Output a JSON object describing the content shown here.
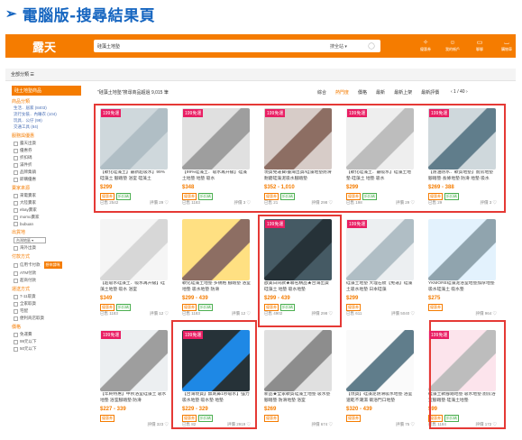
{
  "page_title": {
    "arrow": "➢",
    "text": "電腦版-搜尋結果頁"
  },
  "header": {
    "logo": "露天",
    "search_query": "硅藻土地墊",
    "search_scope": "搜全站 ▾",
    "nav": [
      {
        "icon": "tag-icon",
        "glyph": "✧",
        "label": "優惠券"
      },
      {
        "icon": "user-icon",
        "glyph": "☺",
        "label": "我的帳戶"
      },
      {
        "icon": "chat-icon",
        "glyph": "▭",
        "label": "聊聊"
      },
      {
        "icon": "cart-icon",
        "glyph": "⌴",
        "label": "購物車"
      }
    ]
  },
  "subbar": {
    "all_categories": "全部分類 ☰"
  },
  "sidebar": {
    "header": "硅土地墊商品",
    "sections": [
      {
        "title": "商品分類",
        "links": [
          "生活．居家 (8403)",
          "流行女裝．內睡衣 (104)",
          "玩具．公仔 (99)",
          "交通工具 (84)"
        ]
      },
      {
        "title": "服務與優惠",
        "checks": [
          "露天出貨",
          "優惠券",
          "折扣碼",
          "滿件折",
          "品牌集鎮",
          "即購優惠"
        ]
      },
      {
        "title": "賣家來源",
        "checks": [
          "來電賣家",
          "大陸賣家",
          "ebay賣家",
          "momo賣家",
          "bubuan"
        ]
      },
      {
        "title": "出貨地",
        "select": "台灣地區 ▾",
        "checks": [
          "海外出貨"
        ]
      },
      {
        "title": "付款方式",
        "checks": [
          "信用卡付款",
          "ATM付款",
          "超商付款"
        ],
        "ad": "想申請嗎"
      },
      {
        "title": "運送方式",
        "checks": [
          "7-11取貨",
          "全家取貨",
          "宅配",
          "便利商店取貨"
        ]
      },
      {
        "title": "價格",
        "checks": [
          "免運費",
          "99元以下",
          "50元以下"
        ]
      }
    ]
  },
  "results": {
    "info": "\"硅藻土地墊\"搜尋商品超過 9,015 筆",
    "sort": [
      "綜合",
      "熱門度",
      "價格",
      "最新",
      "最新上架",
      "最新評價"
    ],
    "active_sort": "熱門度",
    "pager": "‹  1 / 40  ›"
  },
  "products": [
    {
      "badge": "199免運",
      "name": "【軟化硅藻土】最新超吸水】99%硅藻土 腳踏墊 浴室 硅藻土",
      "price": "$299",
      "tags": [
        "優惠券",
        "折扣碼"
      ],
      "sold": "已售 2542",
      "rating": "評價 29"
    },
    {
      "badge": "199免運",
      "name": "【99%硅藻土．吸水再升級】硅藻土地墊 地墊 吸水",
      "price": "$348",
      "tags": [
        "優惠券",
        "折扣碼"
      ],
      "sold": "已售 1183",
      "rating": "評價 3"
    },
    {
      "badge": "199免運",
      "name": "現貨免運費/臺灣出貨/硅藻地墊防滑耐磨硅藻泥吸水腳踏墊",
      "price": "$352 - 1,010",
      "tags": [
        "優惠券",
        "折扣碼"
      ],
      "sold": "已售 21",
      "rating": "評價 298"
    },
    {
      "badge": "199免運",
      "name": "【軟化硅藻土．最吸水】硅藻土地墊 硅藻土 地墊 吸水",
      "price": "$299",
      "tags": [
        "優惠券",
        "折扣碼"
      ],
      "sold": "已售 198",
      "rating": "評價 29"
    },
    {
      "badge": "199免運",
      "name": "【防油防水．軟質地墊】廚房地墊 腳踏墊 長條地墊 防滑 地墊 吸水",
      "price": "$269 - 388",
      "tags": [
        "優惠券",
        "折扣碼"
      ],
      "sold": "已售 29",
      "rating": "評價 3"
    },
    {
      "badge": "",
      "name": "【超吸水硅藻土．吸水再升級】硅藻土地墊 吸水 浴室",
      "price": "$349",
      "tags": [
        "優惠券",
        "折扣碼"
      ],
      "sold": "已售 1183",
      "rating": "評價 12"
    },
    {
      "badge": "",
      "name": "軟化硅藻土地墊 多規格 腳踏墊 浴室地墊 吸水地墊 防滑",
      "price": "$299 - 439",
      "tags": [
        "優惠券",
        "折扣碼"
      ],
      "sold": "已售 1183",
      "rating": "評價 12"
    },
    {
      "badge": "199免運",
      "name": "歐美日同款★聯名精品★台灣出貨 硅藻土 地墊 吸水地墊",
      "price": "$299 - 439",
      "tags": [
        "優惠券",
        "折扣碼"
      ],
      "sold": "已售 4902",
      "rating": "評價 298"
    },
    {
      "badge": "199免運",
      "name": "硅藻土地墊 大理石紋【免運】硅藻土吸水地墊 日本硅藻",
      "price": "$299",
      "tags": [
        "優惠券"
      ],
      "sold": "已售 611",
      "rating": "評價 5040"
    },
    {
      "badge": "",
      "name": "YKMORE硅藻泥浴室地墊加厚地墊 吸水硅藻土 吸水墊",
      "price": "$275",
      "tags": [
        "優惠券"
      ],
      "sold": "",
      "rating": "評價 964"
    },
    {
      "badge": "199免運",
      "name": "【年終特惠】中秋浴室硅藻土 吸水地墊 浴室腳踏墊 防滑",
      "price": "$227 - 339",
      "tags": [
        "優惠券"
      ],
      "sold": "",
      "rating": "評價 323"
    },
    {
      "badge": "199免運",
      "name": "【台灣現貨】無刺鼻1秒吸水】強力吸水地墊 吸水墊 地墊",
      "price": "$229 - 329",
      "tags": [
        "優惠券",
        "折扣碼"
      ],
      "sold": "已售 82",
      "rating": "評價 2919"
    },
    {
      "badge": "",
      "name": "新品★全家軟質硅藻土地墊 吸水墊 腳踏墊 防滑地墊 浴室",
      "price": "$269",
      "tags": [
        "優惠券"
      ],
      "sold": "",
      "rating": "評價 674"
    },
    {
      "badge": "",
      "name": "【現貨】硅藻泥防滑吸水地墊 浴室速乾不潮濕 衛浴門口地墊",
      "price": "$320 - 439",
      "tags": [
        "優惠券"
      ],
      "sold": "",
      "rating": "評價 75"
    },
    {
      "badge": "199免運",
      "name": "硅藻土軟腳踏地墊 吸水地墊 廚房浴室腳踏墊 硅藻土地墊",
      "price": "$99",
      "tags": [
        "優惠券",
        "折扣碼"
      ],
      "sold": "已售 1184",
      "rating": "評價 172"
    }
  ],
  "colors": {
    "brand": "#f57c00",
    "badge": "#e91e63",
    "highlight": "#e53935",
    "title": "#1565c0"
  }
}
